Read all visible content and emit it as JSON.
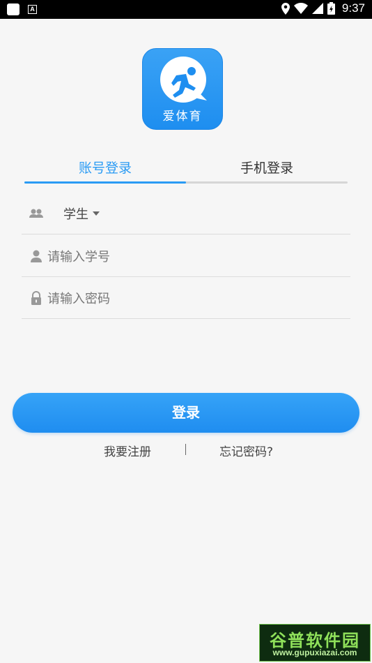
{
  "status_bar": {
    "time": "9:37",
    "icons": [
      "app-square-icon",
      "a-notification-icon",
      "location-icon",
      "wifi-icon",
      "signal-icon",
      "battery-icon"
    ]
  },
  "app": {
    "name": "爱体育",
    "brand_color": "#2a9bf4"
  },
  "tabs": [
    {
      "label": "账号登录",
      "active": true
    },
    {
      "label": "手机登录",
      "active": false
    }
  ],
  "form": {
    "role": {
      "value": "学生",
      "icon": "users-icon"
    },
    "student_id": {
      "placeholder": "请输入学号",
      "icon": "user-icon"
    },
    "password": {
      "placeholder": "请输入密码",
      "icon": "lock-icon"
    }
  },
  "login_button": {
    "label": "登录"
  },
  "links": {
    "register": "我要注册",
    "separator": "|",
    "forgot": "忘记密码?"
  },
  "watermark": {
    "title": "谷普软件园",
    "url": "www.gupuxiazai.com"
  }
}
